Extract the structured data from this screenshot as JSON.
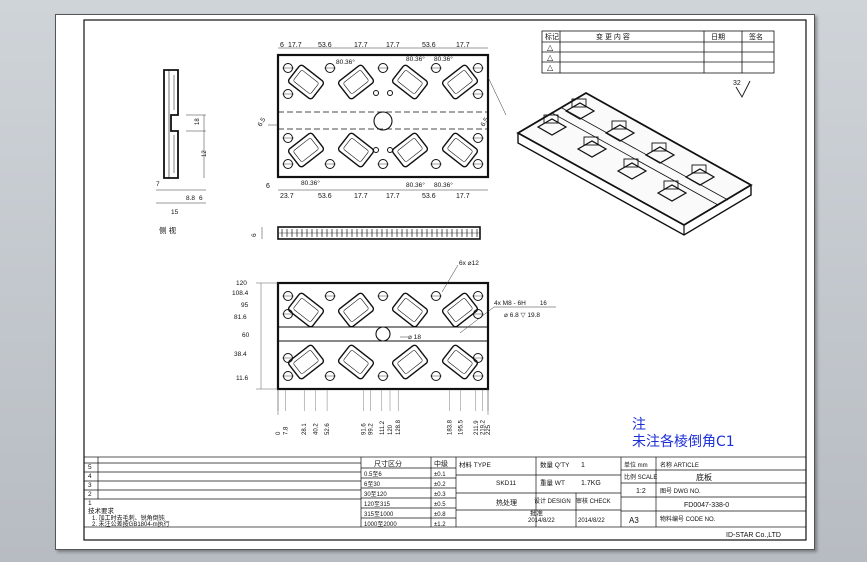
{
  "colors": {
    "ink": "#111111",
    "dim": "#3a3a3a",
    "note": "#1c2fd6",
    "sheet": "#ffffff"
  },
  "top_view": {
    "dims_top": [
      "6",
      "17.7",
      "53.6",
      "17.7",
      "17.7",
      "53.6",
      "17.7"
    ],
    "angles_top": [
      "80.36°",
      "80.36°",
      "80.36°",
      "80.36°"
    ],
    "dims_bottom": [
      "6",
      "23.7",
      "53.6",
      "17.7",
      "17.7",
      "53.6",
      "17.7"
    ],
    "angles_bottom": [
      "80.36°",
      "80.36°",
      "80.36°",
      "80.36°"
    ],
    "side_diam_left": "6.5",
    "side_diam_right": "6.5"
  },
  "side_view": {
    "dims": [
      "7",
      "8.8",
      "6",
      "15"
    ],
    "labels": [
      "18",
      "12"
    ],
    "caption": "侧 视"
  },
  "front_strip": {
    "dim": "6"
  },
  "bottom_view": {
    "y_dims": [
      "120",
      "108.4",
      "95",
      "81.6",
      "60",
      "38.4",
      "11.6"
    ],
    "x_dims": [
      "0",
      "7.8",
      "28.1",
      "40.2",
      "52.6",
      "91.6",
      "99.2",
      "111.2",
      "120",
      "128.8",
      "183.8",
      "195.5",
      "211.9",
      "219.2",
      "225"
    ],
    "callout_a": "6x ⌀12",
    "callout_b_line1": "4x M8 - 6H",
    "callout_b_line2": "⌀ 6.8 ▽ 19.8",
    "callout_b_depth": "16",
    "callout_c": "⌀ 18"
  },
  "revision_table": {
    "headers": [
      "标记",
      "变  更  内  容",
      "日期",
      "签名"
    ],
    "rows": [
      "△",
      "△",
      "△"
    ]
  },
  "roughness": "32",
  "note": {
    "title": "注",
    "body": "未注各棱倒角C1"
  },
  "title_block": {
    "tech_title": "技术要求",
    "tech_lines": [
      "1. 加工时去毛刺、锐角倒钝",
      "2. 未注公差按GB1804-m执行"
    ],
    "row_nums": [
      "5",
      "4",
      "3",
      "2",
      "1"
    ],
    "tol_header": [
      "尺寸区分",
      "中级"
    ],
    "tol_rows": [
      [
        "0.5至6",
        "±0.1"
      ],
      [
        "6至30",
        "±0.2"
      ],
      [
        "30至120",
        "±0.3"
      ],
      [
        "120至315",
        "±0.5"
      ],
      [
        "315至1000",
        "±0.8"
      ],
      [
        "1000至2000",
        "±1.2"
      ]
    ],
    "material": "材料 TYPE",
    "material_val": "SKD11",
    "heat": "热处理",
    "qty_label": "数量 Q'TY",
    "qty": "1",
    "weight_label": "重量 WT",
    "weight": "1.7KG",
    "scale_label": "比例 SCALE",
    "scale": "1:2",
    "design_label": "设计 DESIGN",
    "design_date": "2014/8/22",
    "check_label": "审核 CHECK",
    "check_date": "2014/8/22",
    "approve_label": "批准",
    "unit_label": "单位 mm",
    "sheet_size": "A3",
    "part_name_label": "名称 ARTICLE",
    "part_name": "底板",
    "drawing_no_label": "图号 DWG NO.",
    "drawing_no": "FD0047-338-0",
    "code_label": "物料编号 CODE NO.",
    "company": "ID-STAR Co.,LTD",
    "misc": [
      "技术要求",
      "比 例",
      "12"
    ]
  }
}
